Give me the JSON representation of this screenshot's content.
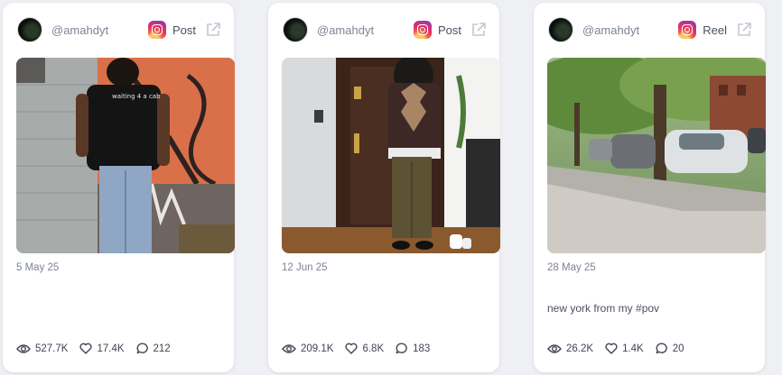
{
  "colors": {
    "page_bg": "#eef0f4",
    "card_bg": "#ffffff",
    "muted_text": "#7b8494",
    "stat_text": "#3e4553",
    "instagram_gradient": [
      "#fdc468",
      "#e1306c",
      "#833ab4"
    ]
  },
  "cards": [
    {
      "handle": "@amahdyt",
      "platform_icon": "instagram-icon",
      "post_type": "Post",
      "media_description_icon": "photo",
      "date": "5 May 25",
      "caption": "",
      "stats": {
        "views": "527.7K",
        "likes": "17.4K",
        "comments": "212"
      }
    },
    {
      "handle": "@amahdyt",
      "platform_icon": "instagram-icon",
      "post_type": "Post",
      "media_description_icon": "photo",
      "date": "12 Jun 25",
      "caption": "",
      "stats": {
        "views": "209.1K",
        "likes": "6.8K",
        "comments": "183"
      }
    },
    {
      "handle": "@amahdyt",
      "platform_icon": "instagram-icon",
      "post_type": "Reel",
      "media_description_icon": "video",
      "date": "28 May 25",
      "caption": "new york from my #pov",
      "stats": {
        "views": "26.2K",
        "likes": "1.4K",
        "comments": "20"
      }
    }
  ],
  "media_overlay_text": "waiting 4 a cab"
}
